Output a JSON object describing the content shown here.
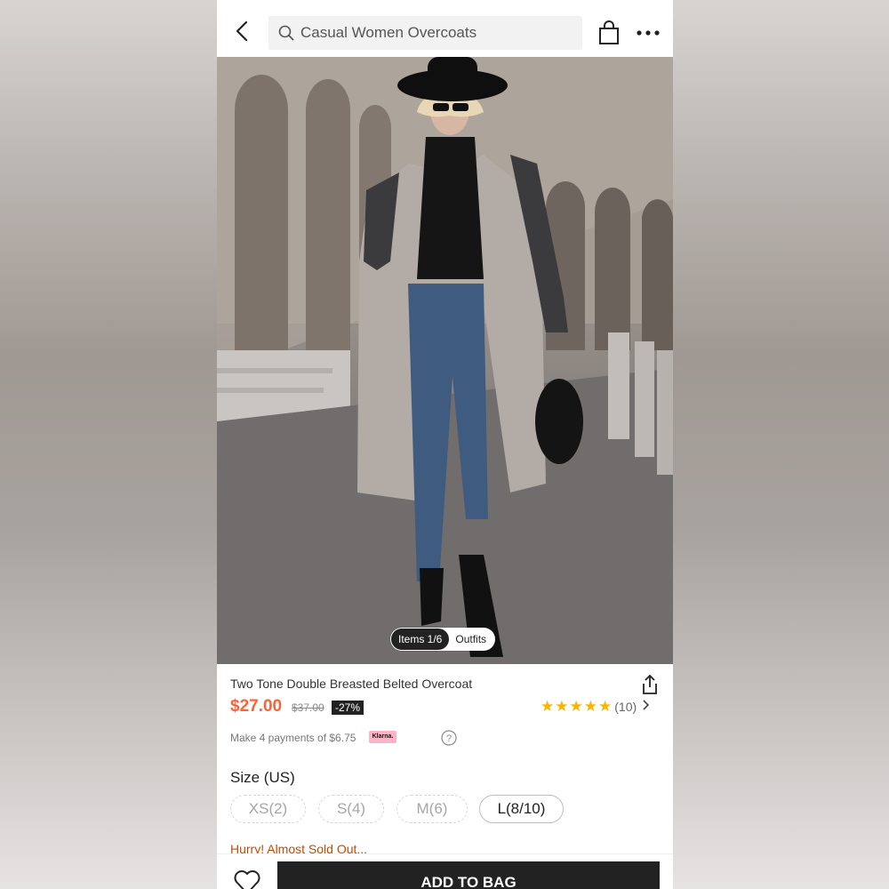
{
  "header": {
    "search_text": "Casual Women Overcoats"
  },
  "gallery": {
    "items_label": "Items 1/6",
    "outfits_label": "Outfits"
  },
  "product": {
    "title": "Two Tone Double Breasted Belted Overcoat",
    "price": "$27.00",
    "original_price": "$37.00",
    "discount": "-27%",
    "rating_stars": 5,
    "review_count": "(10)",
    "payments_text": "Make 4 payments of $6.75",
    "klarna_label": "Klarna."
  },
  "size": {
    "label": "Size (US)",
    "options": [
      {
        "label": "XS(2)",
        "available": false
      },
      {
        "label": "S(4)",
        "available": false
      },
      {
        "label": "M(6)",
        "available": false
      },
      {
        "label": "L(8/10)",
        "available": true
      }
    ]
  },
  "stock_message": "Hurry! Almost Sold Out...",
  "actions": {
    "add_to_bag": "ADD TO BAG"
  },
  "colors": {
    "price": "#fa6338",
    "star": "#f7b500",
    "hurry": "#c44a01",
    "button": "#222222"
  }
}
